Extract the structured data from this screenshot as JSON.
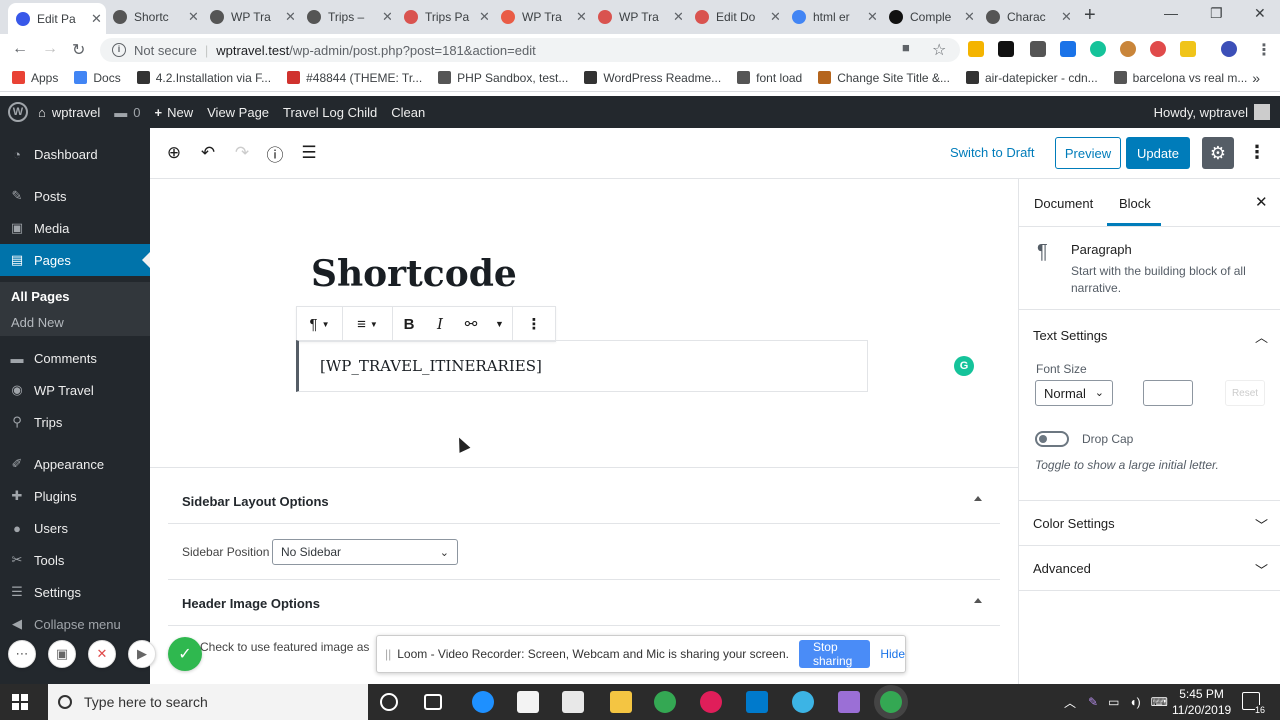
{
  "browser": {
    "tabs": [
      {
        "title": "Edit Pa",
        "color": "#3858e9",
        "active": true
      },
      {
        "title": "Shortc",
        "color": "#555"
      },
      {
        "title": "WP Tra",
        "color": "#555"
      },
      {
        "title": "Trips –",
        "color": "#555"
      },
      {
        "title": "Trips Pa",
        "color": "#d9534f"
      },
      {
        "title": "WP Tra",
        "color": "#e95c46"
      },
      {
        "title": "WP Tra",
        "color": "#d9534f"
      },
      {
        "title": "Edit Do",
        "color": "#d9534f"
      },
      {
        "title": "html er",
        "color": "#4285f4"
      },
      {
        "title": "Comple",
        "color": "#111"
      },
      {
        "title": "Charac",
        "color": "#555"
      }
    ],
    "not_secure": "Not secure",
    "url_host": "wptravel.test",
    "url_path": "/wp-admin/post.php?post=181&action=edit",
    "bookmarks": [
      {
        "label": "Apps",
        "color": "#e94235"
      },
      {
        "label": "Docs",
        "color": "#4285f4"
      },
      {
        "label": "4.2.Installation via F...",
        "color": "#333"
      },
      {
        "label": "#48844 (THEME: Tr...",
        "color": "#d0322e"
      },
      {
        "label": "PHP Sandbox, test...",
        "color": "#555"
      },
      {
        "label": "WordPress Readme...",
        "color": "#333"
      },
      {
        "label": "font load",
        "color": "#555"
      },
      {
        "label": "Change Site Title &...",
        "color": "#b5651d"
      },
      {
        "label": "air-datepicker - cdn...",
        "color": "#333"
      },
      {
        "label": "barcelona vs real m...",
        "color": "#555"
      }
    ]
  },
  "adminbar": {
    "site": "wptravel",
    "comments": "0",
    "new": "New",
    "view_page": "View Page",
    "travel_log": "Travel Log Child",
    "clean": "Clean",
    "howdy": "Howdy, wptravel"
  },
  "sidebar": {
    "items": [
      {
        "label": "Dashboard",
        "icon": "◔"
      },
      {
        "label": "Posts",
        "icon": "✎"
      },
      {
        "label": "Media",
        "icon": "▣"
      },
      {
        "label": "Pages",
        "icon": "▤",
        "current": true
      },
      {
        "label": "Comments",
        "icon": "▬"
      },
      {
        "label": "WP Travel",
        "icon": "◉"
      },
      {
        "label": "Trips",
        "icon": "⚲"
      },
      {
        "label": "Appearance",
        "icon": "✐"
      },
      {
        "label": "Plugins",
        "icon": "✚"
      },
      {
        "label": "Users",
        "icon": "●"
      },
      {
        "label": "Tools",
        "icon": "✂"
      },
      {
        "label": "Settings",
        "icon": "☰"
      },
      {
        "label": "Collapse menu",
        "icon": "◀"
      }
    ],
    "sub_all_pages": "All Pages",
    "sub_add_new": "Add New"
  },
  "editor": {
    "switch_draft": "Switch to Draft",
    "preview": "Preview",
    "update": "Update",
    "title": "Shortcode",
    "paragraph": "[WP_TRAVEL_ITINERARIES]"
  },
  "metaboxes": {
    "sidebar_layout": "Sidebar Layout Options",
    "sidebar_position_label": "Sidebar Position",
    "sidebar_position_value": "No Sidebar",
    "header_image": "Header Image Options",
    "featured_text": "Check to use featured image as"
  },
  "panel": {
    "tab_document": "Document",
    "tab_block": "Block",
    "block_name": "Paragraph",
    "block_desc": "Start with the building block of all narrative.",
    "text_settings": "Text Settings",
    "font_size_label": "Font Size",
    "font_size_value": "Normal",
    "reset": "Reset",
    "drop_cap": "Drop Cap",
    "drop_cap_help": "Toggle to show a large initial letter.",
    "color_settings": "Color Settings",
    "advanced": "Advanced"
  },
  "loom": {
    "message": "Loom - Video Recorder: Screen, Webcam and Mic is sharing your screen.",
    "stop": "Stop sharing",
    "hide": "Hide"
  },
  "taskbar": {
    "search_placeholder": "Type here to search",
    "time": "5:45 PM",
    "date": "11/20/2019",
    "notifications": "16"
  },
  "colors": {
    "wp_blue": "#007cba",
    "admin_dark": "#23282d",
    "menu_current": "#0073aa"
  }
}
